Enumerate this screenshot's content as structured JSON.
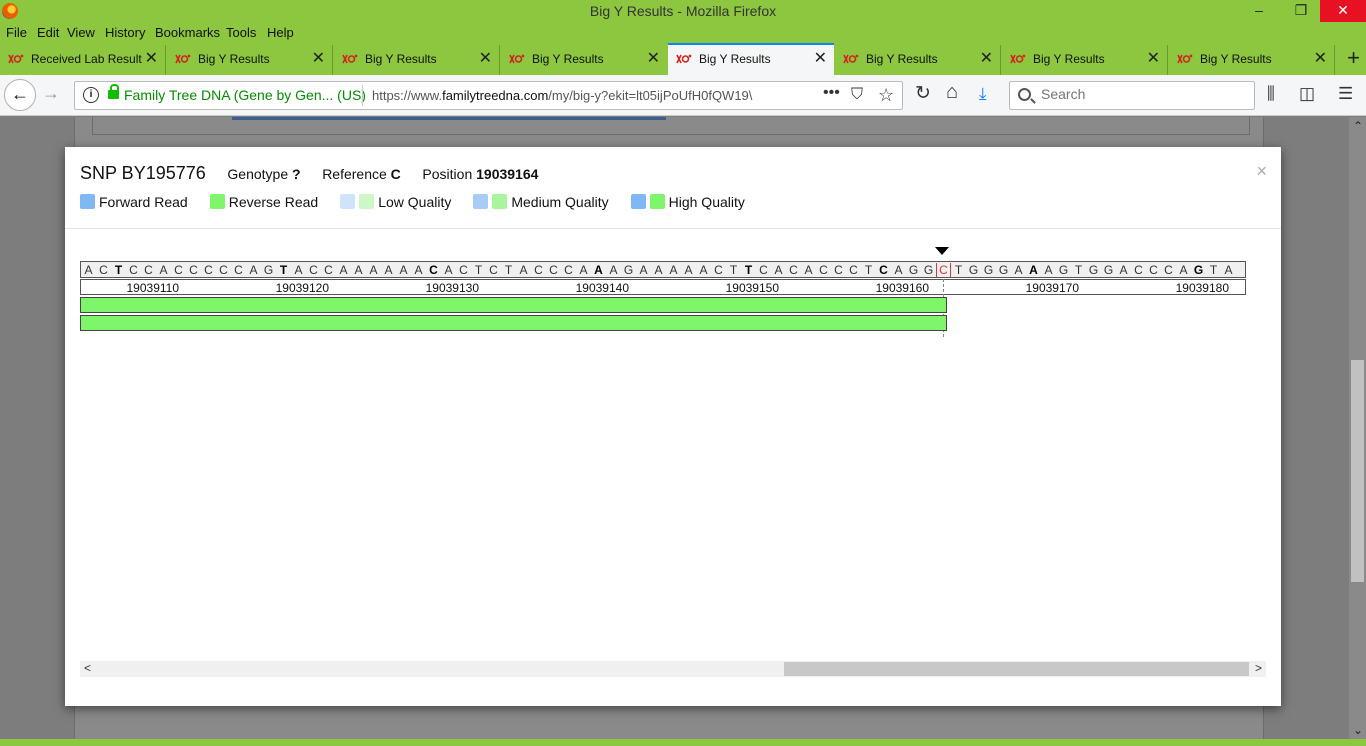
{
  "window": {
    "title": "Big Y Results - Mozilla Firefox",
    "minimize": "–",
    "maximize": "❐",
    "close": "✕"
  },
  "menu": [
    "File",
    "Edit",
    "View",
    "History",
    "Bookmarks",
    "Tools",
    "Help"
  ],
  "tabs": [
    {
      "label": "Received Lab Result",
      "active": false
    },
    {
      "label": "Big Y Results",
      "active": false
    },
    {
      "label": "Big Y Results",
      "active": false
    },
    {
      "label": "Big Y Results",
      "active": false
    },
    {
      "label": "Big Y Results",
      "active": true
    },
    {
      "label": "Big Y Results",
      "active": false
    },
    {
      "label": "Big Y Results",
      "active": false
    },
    {
      "label": "Big Y Results",
      "active": false
    }
  ],
  "tab_close": "✕",
  "new_tab": "+",
  "nav": {
    "back": "←",
    "forward": "→",
    "site_identity": "Family Tree DNA (Gene by Gen...  (US)",
    "url_prefix": "https://www.",
    "url_domain": "familytreedna.com",
    "url_rest": "/my/big-y?ekit=lt05ijPoUfH0fQW19\\",
    "page_actions": "•••",
    "pocket": "⛉",
    "bookmark_star": "☆",
    "reload": "↻",
    "home": "⌂",
    "download": "⤓",
    "library": "⫼",
    "sidebar": "◫",
    "menu": "☰",
    "search_placeholder": "Search"
  },
  "snp": {
    "title": "SNP BY195776",
    "genotype_label": "Genotype",
    "genotype_value": "?",
    "reference_label": "Reference",
    "reference_value": "C",
    "position_label": "Position",
    "position_value": "19039164",
    "close": "×"
  },
  "legend": [
    {
      "label": "Forward Read",
      "swatches": [
        "#80b8f5"
      ]
    },
    {
      "label": "Reverse Read",
      "swatches": [
        "#7ef56b"
      ]
    },
    {
      "label": "Low Quality",
      "swatches": [
        "#cfe3fb",
        "#cdf8c6"
      ]
    },
    {
      "label": "Medium Quality",
      "swatches": [
        "#a9cbf8",
        "#a8f59c"
      ]
    },
    {
      "label": "High Quality",
      "swatches": [
        "#80b8f5",
        "#7ef56b"
      ]
    }
  ],
  "viewer": {
    "sequence": "ACTCCACCCCCAGTACCAAAAAACACTCTACCCAAAGAAAAACTTCACACCCTCAGGCTGGGAAAGTGGACCCAGTA",
    "bold_indices": [
      2,
      13,
      23,
      34,
      44,
      53,
      63,
      74
    ],
    "reference_index": 57,
    "tick_labels": [
      "19039110",
      "19039120",
      "19039130",
      "19039140",
      "19039150",
      "19039160",
      "19039170",
      "19039180"
    ],
    "reads": [
      {
        "strand": "reverse",
        "end_index": 57
      },
      {
        "strand": "reverse",
        "end_index": 57
      }
    ]
  },
  "hscroll": {
    "left": "<",
    "right": ">"
  },
  "page_scroll": {
    "up": "⌃",
    "down": "⌄"
  }
}
